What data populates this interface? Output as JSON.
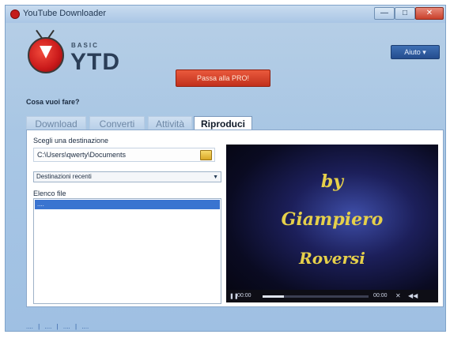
{
  "window": {
    "title": "YouTube Downloader",
    "minimize_icon": "minimize-icon",
    "maximize_icon": "maximize-icon",
    "close_icon": "close-icon"
  },
  "logo": {
    "basic": "BASIC",
    "name": "YTD"
  },
  "header": {
    "pro_button": "Passa alla PRO!",
    "help_button": "Aiuto ▾"
  },
  "prompt": "Cosa vuoi fare?",
  "tabs": [
    {
      "label": "Download"
    },
    {
      "label": "Converti"
    },
    {
      "label": "Attività"
    },
    {
      "label": "Riproduci",
      "active": true
    }
  ],
  "play": {
    "destination_label": "Scegli una destinazione",
    "path_value": "C:\\Users\\qwerty\\Documents",
    "recent_label": "Destinazioni recenti",
    "files_label": "Elenco file",
    "files": [
      "...."
    ]
  },
  "video": {
    "line1": "by",
    "line2": "Giampiero",
    "line3": "Roversi",
    "time_elapsed": "00:00",
    "time_total": "00:00",
    "progress": 0.2
  },
  "footer": {
    "links": [
      "....",
      "....",
      "....",
      "...."
    ]
  },
  "colors": {
    "accent_red": "#c9301c",
    "help_blue": "#2b5aa0",
    "selection_blue": "#3a74d0",
    "video_text": "#e6d04a"
  }
}
